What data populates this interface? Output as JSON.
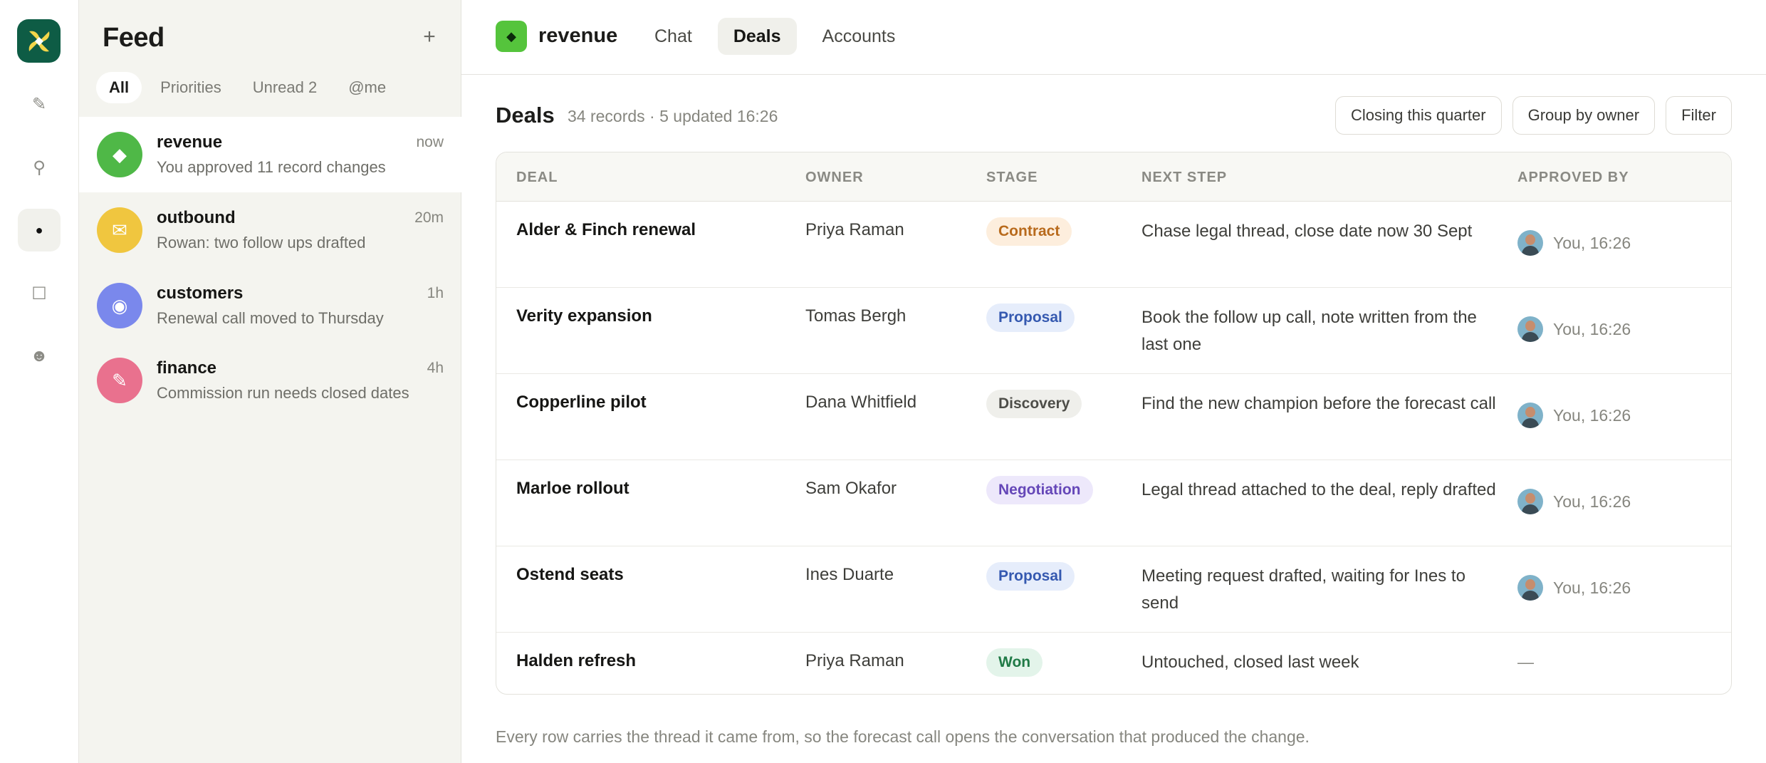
{
  "rail": {
    "items": [
      {
        "icon": "pencil-icon",
        "glyph": "✎"
      },
      {
        "icon": "search-icon",
        "glyph": "⚲"
      },
      {
        "icon": "dot-icon",
        "glyph": "●"
      },
      {
        "icon": "square-icon",
        "glyph": "☐"
      },
      {
        "icon": "smiley-icon",
        "glyph": "☻"
      }
    ]
  },
  "feed": {
    "title": "Feed",
    "add_glyph": "+",
    "filters": [
      "All",
      "Priorities",
      "Unread 2",
      "@me"
    ],
    "items": [
      {
        "name": "revenue",
        "time": "now",
        "sub": "You approved 11 record changes",
        "glyph": "◆",
        "color": "#4fb847"
      },
      {
        "name": "outbound",
        "time": "20m",
        "sub": "Rowan: two follow ups drafted",
        "glyph": "✉",
        "color": "#f0c63f"
      },
      {
        "name": "customers",
        "time": "1h",
        "sub": "Renewal call moved to Thursday",
        "glyph": "◉",
        "color": "#7a88ec"
      },
      {
        "name": "finance",
        "time": "4h",
        "sub": "Commission run needs closed dates",
        "glyph": "✎",
        "color": "#e9718e"
      }
    ]
  },
  "header": {
    "workspace_glyph": "◆",
    "workspace": "revenue",
    "tabs": [
      "Chat",
      "Deals",
      "Accounts"
    ]
  },
  "deals": {
    "title": "Deals",
    "meta": "34 records · 5 updated 16:26",
    "actions": [
      "Closing this quarter",
      "Group by owner",
      "Filter"
    ],
    "columns": [
      "DEAL",
      "OWNER",
      "STAGE",
      "NEXT STEP",
      "APPROVED BY"
    ],
    "rows": [
      {
        "deal": "Alder & Finch renewal",
        "owner": "Priya Raman",
        "stage": "Contract",
        "next": "Chase legal thread, close date now 30 Sept",
        "approved": "You, 16:26"
      },
      {
        "deal": "Verity expansion",
        "owner": "Tomas Bergh",
        "stage": "Proposal",
        "next": "Book the follow up call, note written from the last one",
        "approved": "You, 16:26"
      },
      {
        "deal": "Copperline pilot",
        "owner": "Dana Whitfield",
        "stage": "Discovery",
        "next": "Find the new champion before the forecast call",
        "approved": "You, 16:26"
      },
      {
        "deal": "Marloe rollout",
        "owner": "Sam Okafor",
        "stage": "Negotiation",
        "next": "Legal thread attached to the deal, reply drafted",
        "approved": "You, 16:26"
      },
      {
        "deal": "Ostend seats",
        "owner": "Ines Duarte",
        "stage": "Proposal",
        "next": "Meeting request drafted, waiting for Ines to send",
        "approved": "You, 16:26"
      },
      {
        "deal": "Halden refresh",
        "owner": "Priya Raman",
        "stage": "Won",
        "next": "Untouched, closed last week",
        "approved": "—"
      }
    ],
    "stage_colors": {
      "Contract": {
        "bg": "#fdeedd",
        "fg": "#b86a1c"
      },
      "Proposal": {
        "bg": "#e6edfb",
        "fg": "#3559b0"
      },
      "Discovery": {
        "bg": "#efefeb",
        "fg": "#4d4d48"
      },
      "Negotiation": {
        "bg": "#ede8fb",
        "fg": "#6547b8"
      },
      "Won": {
        "bg": "#e3f4ea",
        "fg": "#1f7a46"
      }
    },
    "footnote": "Every row carries the thread it came from, so the forecast call opens the conversation that produced the change."
  },
  "colors": {
    "brand": "#0e5c45",
    "workspace": "#55c43c"
  }
}
